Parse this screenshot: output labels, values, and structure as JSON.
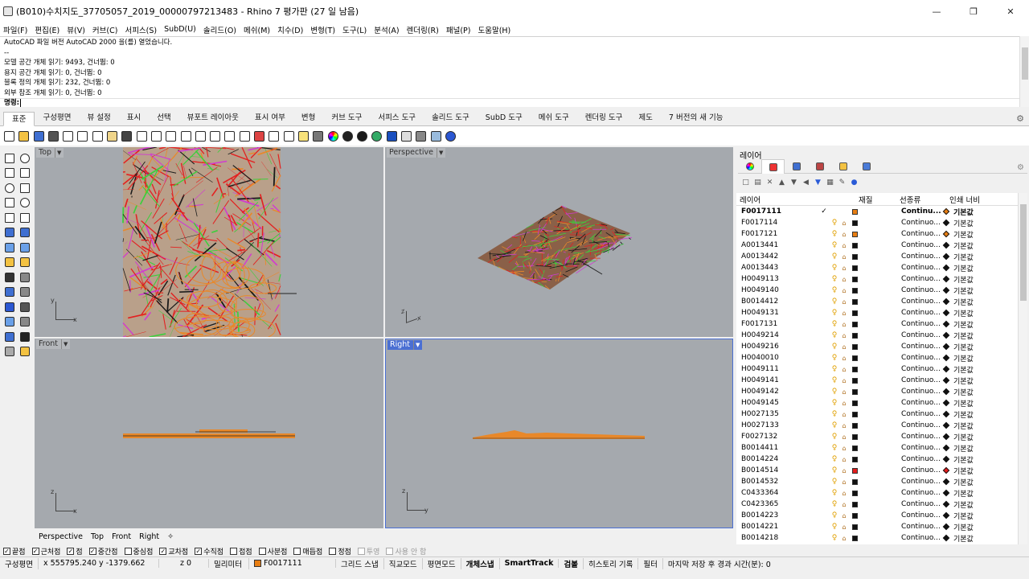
{
  "window": {
    "title": "(B010)수치지도_37705057_2019_00000797213483 - Rhino 7 평가판 (27 일 남음)",
    "controls": [
      "—",
      "❐",
      "✕"
    ]
  },
  "menu": [
    "파일(F)",
    "편집(E)",
    "뷰(V)",
    "커브(C)",
    "서피스(S)",
    "SubD(U)",
    "솔리드(O)",
    "메쉬(M)",
    "치수(D)",
    "변형(T)",
    "도구(L)",
    "분석(A)",
    "렌더링(R)",
    "패널(P)",
    "도움말(H)"
  ],
  "command_history": [
    "AutoCAD 파일 버전 AutoCAD 2000 을(를) 열었습니다.",
    "--",
    "모델 공간 개체 읽기: 9493, 건너뜀: 0",
    "용지 공간 개체 읽기: 0, 건너뜀: 0",
    "블록 정의 개체 읽기: 232, 건너뜀: 0",
    "외부 참조 개체 읽기: 0, 건너뜀: 0"
  ],
  "command_prompt": "명령:",
  "toolbar_tabs": [
    "표준",
    "구성평면",
    "뷰 설정",
    "표시",
    "선택",
    "뷰포트 레이아웃",
    "표시 여부",
    "변형",
    "커브 도구",
    "서피스 도구",
    "솔리드 도구",
    "SubD 도구",
    "메쉬 도구",
    "렌더링 도구",
    "제도",
    "7 버전의 새 기능"
  ],
  "active_tab": "표준",
  "toolbar_icons": [
    "new-icon",
    "open-icon",
    "save-icon",
    "print-icon",
    "import-icon",
    "cut-icon",
    "copy-icon",
    "paste-icon",
    "undo-icon",
    "pan-icon",
    "rotate-view-icon",
    "zoom-dynamic-icon",
    "zoom-window-icon",
    "zoom-extents-icon",
    "zoom-selected-icon",
    "undo-view-icon",
    "viewport-layout-icon",
    "set-view-icon",
    "cplane-icon",
    "select-icon",
    "lightbulb-icon",
    "lock-icon",
    "color-wheel-icon",
    "render-sphere-icon",
    "material-icon",
    "environment-icon",
    "sun-icon",
    "settings-icon",
    "options-icon",
    "render-icon",
    "help-icon"
  ],
  "viewports": {
    "top": {
      "label": "Top",
      "axis1": "y",
      "axis2": "x"
    },
    "perspective": {
      "label": "Perspective",
      "axis1": "z",
      "axis2": "x"
    },
    "front": {
      "label": "Front",
      "axis1": "z",
      "axis2": "x"
    },
    "right": {
      "label": "Right",
      "axis1": "z",
      "axis2": "y"
    }
  },
  "viewport_tabs": [
    "Perspective",
    "Top",
    "Front",
    "Right",
    "✧"
  ],
  "osnaps": [
    {
      "label": "끝점",
      "checked": true,
      "enabled": true
    },
    {
      "label": "근처점",
      "checked": true,
      "enabled": true
    },
    {
      "label": "점",
      "checked": true,
      "enabled": true
    },
    {
      "label": "중간점",
      "checked": true,
      "enabled": true
    },
    {
      "label": "중심점",
      "checked": false,
      "enabled": true
    },
    {
      "label": "교차점",
      "checked": true,
      "enabled": true
    },
    {
      "label": "수직점",
      "checked": true,
      "enabled": true
    },
    {
      "label": "접점",
      "checked": false,
      "enabled": true
    },
    {
      "label": "사분점",
      "checked": false,
      "enabled": true
    },
    {
      "label": "매듭점",
      "checked": false,
      "enabled": true
    },
    {
      "label": "정점",
      "checked": false,
      "enabled": true
    },
    {
      "label": "투영",
      "checked": false,
      "enabled": false
    },
    {
      "label": "사용 안 함",
      "checked": false,
      "enabled": false
    }
  ],
  "status": {
    "cplane": "구성평면",
    "coords": "x 555795.240 y -1379.662",
    "z": "z 0",
    "units": "밀리미터",
    "current_layer": "F0017111",
    "layer_color": "#e87e12",
    "grid_snap": "그리드 스냅",
    "ortho": "직교모드",
    "planar": "평면모드",
    "osnap": "개체스냅",
    "smarttrack": "SmartTrack",
    "gumball": "검볼",
    "history": "히스토리 기록",
    "filter": "필터",
    "autosave": "마지막 저장 후 경과 시간(분): 0"
  },
  "layer_panel": {
    "title": "레이어",
    "tab_icons": [
      "layers-tab-icon",
      "display-tab-icon",
      "properties-tab-icon",
      "render-tab-icon",
      "files-tab-icon",
      "library-tab-icon"
    ],
    "columns": {
      "name": "레이어",
      "material": "재질",
      "linetype": "선종류",
      "printwidth": "인쇄 너비"
    },
    "rows": [
      {
        "name": "F0017111",
        "current": true,
        "color": "#e87e12",
        "linetype": "Continu...",
        "pw": "기본값",
        "pwcolor": "#e87e12"
      },
      {
        "name": "F0017114",
        "current": false,
        "color": "#111111",
        "linetype": "Continuo...",
        "pw": "기본값",
        "pwcolor": "#111111"
      },
      {
        "name": "F0017121",
        "current": false,
        "color": "#e87e12",
        "linetype": "Continuo...",
        "pw": "기본값",
        "pwcolor": "#e87e12"
      },
      {
        "name": "A0013441",
        "current": false,
        "color": "#111111",
        "linetype": "Continuo...",
        "pw": "기본값",
        "pwcolor": "#111111"
      },
      {
        "name": "A0013442",
        "current": false,
        "color": "#111111",
        "linetype": "Continuo...",
        "pw": "기본값",
        "pwcolor": "#111111"
      },
      {
        "name": "A0013443",
        "current": false,
        "color": "#111111",
        "linetype": "Continuo...",
        "pw": "기본값",
        "pwcolor": "#111111"
      },
      {
        "name": "H0049113",
        "current": false,
        "color": "#111111",
        "linetype": "Continuo...",
        "pw": "기본값",
        "pwcolor": "#111111"
      },
      {
        "name": "H0049140",
        "current": false,
        "color": "#111111",
        "linetype": "Continuo...",
        "pw": "기본값",
        "pwcolor": "#111111"
      },
      {
        "name": "B0014412",
        "current": false,
        "color": "#111111",
        "linetype": "Continuo...",
        "pw": "기본값",
        "pwcolor": "#111111"
      },
      {
        "name": "H0049131",
        "current": false,
        "color": "#111111",
        "linetype": "Continuo...",
        "pw": "기본값",
        "pwcolor": "#111111"
      },
      {
        "name": "F0017131",
        "current": false,
        "color": "#111111",
        "linetype": "Continuo...",
        "pw": "기본값",
        "pwcolor": "#111111"
      },
      {
        "name": "H0049214",
        "current": false,
        "color": "#111111",
        "linetype": "Continuo...",
        "pw": "기본값",
        "pwcolor": "#111111"
      },
      {
        "name": "H0049216",
        "current": false,
        "color": "#111111",
        "linetype": "Continuo...",
        "pw": "기본값",
        "pwcolor": "#111111"
      },
      {
        "name": "H0040010",
        "current": false,
        "color": "#111111",
        "linetype": "Continuo...",
        "pw": "기본값",
        "pwcolor": "#111111"
      },
      {
        "name": "H0049111",
        "current": false,
        "color": "#111111",
        "linetype": "Continuo...",
        "pw": "기본값",
        "pwcolor": "#111111"
      },
      {
        "name": "H0049141",
        "current": false,
        "color": "#111111",
        "linetype": "Continuo...",
        "pw": "기본값",
        "pwcolor": "#111111"
      },
      {
        "name": "H0049142",
        "current": false,
        "color": "#111111",
        "linetype": "Continuo...",
        "pw": "기본값",
        "pwcolor": "#111111"
      },
      {
        "name": "H0049145",
        "current": false,
        "color": "#111111",
        "linetype": "Continuo...",
        "pw": "기본값",
        "pwcolor": "#111111"
      },
      {
        "name": "H0027135",
        "current": false,
        "color": "#111111",
        "linetype": "Continuo...",
        "pw": "기본값",
        "pwcolor": "#111111"
      },
      {
        "name": "H0027133",
        "current": false,
        "color": "#111111",
        "linetype": "Continuo...",
        "pw": "기본값",
        "pwcolor": "#111111"
      },
      {
        "name": "F0027132",
        "current": false,
        "color": "#111111",
        "linetype": "Continuo...",
        "pw": "기본값",
        "pwcolor": "#111111"
      },
      {
        "name": "B0014411",
        "current": false,
        "color": "#111111",
        "linetype": "Continuo...",
        "pw": "기본값",
        "pwcolor": "#111111"
      },
      {
        "name": "B0014224",
        "current": false,
        "color": "#111111",
        "linetype": "Continuo...",
        "pw": "기본값",
        "pwcolor": "#111111"
      },
      {
        "name": "B0014514",
        "current": false,
        "color": "#e41c1c",
        "linetype": "Continuo...",
        "pw": "기본값",
        "pwcolor": "#e41c1c"
      },
      {
        "name": "B0014532",
        "current": false,
        "color": "#111111",
        "linetype": "Continuo...",
        "pw": "기본값",
        "pwcolor": "#111111"
      },
      {
        "name": "C0433364",
        "current": false,
        "color": "#111111",
        "linetype": "Continuo...",
        "pw": "기본값",
        "pwcolor": "#111111"
      },
      {
        "name": "C0423365",
        "current": false,
        "color": "#111111",
        "linetype": "Continuo...",
        "pw": "기본값",
        "pwcolor": "#111111"
      },
      {
        "name": "B0014223",
        "current": false,
        "color": "#111111",
        "linetype": "Continuo...",
        "pw": "기본값",
        "pwcolor": "#111111"
      },
      {
        "name": "B0014221",
        "current": false,
        "color": "#111111",
        "linetype": "Continuo...",
        "pw": "기본값",
        "pwcolor": "#111111"
      },
      {
        "name": "B0014218",
        "current": false,
        "color": "#111111",
        "linetype": "Continuo...",
        "pw": "기본값",
        "pwcolor": "#111111"
      }
    ]
  }
}
